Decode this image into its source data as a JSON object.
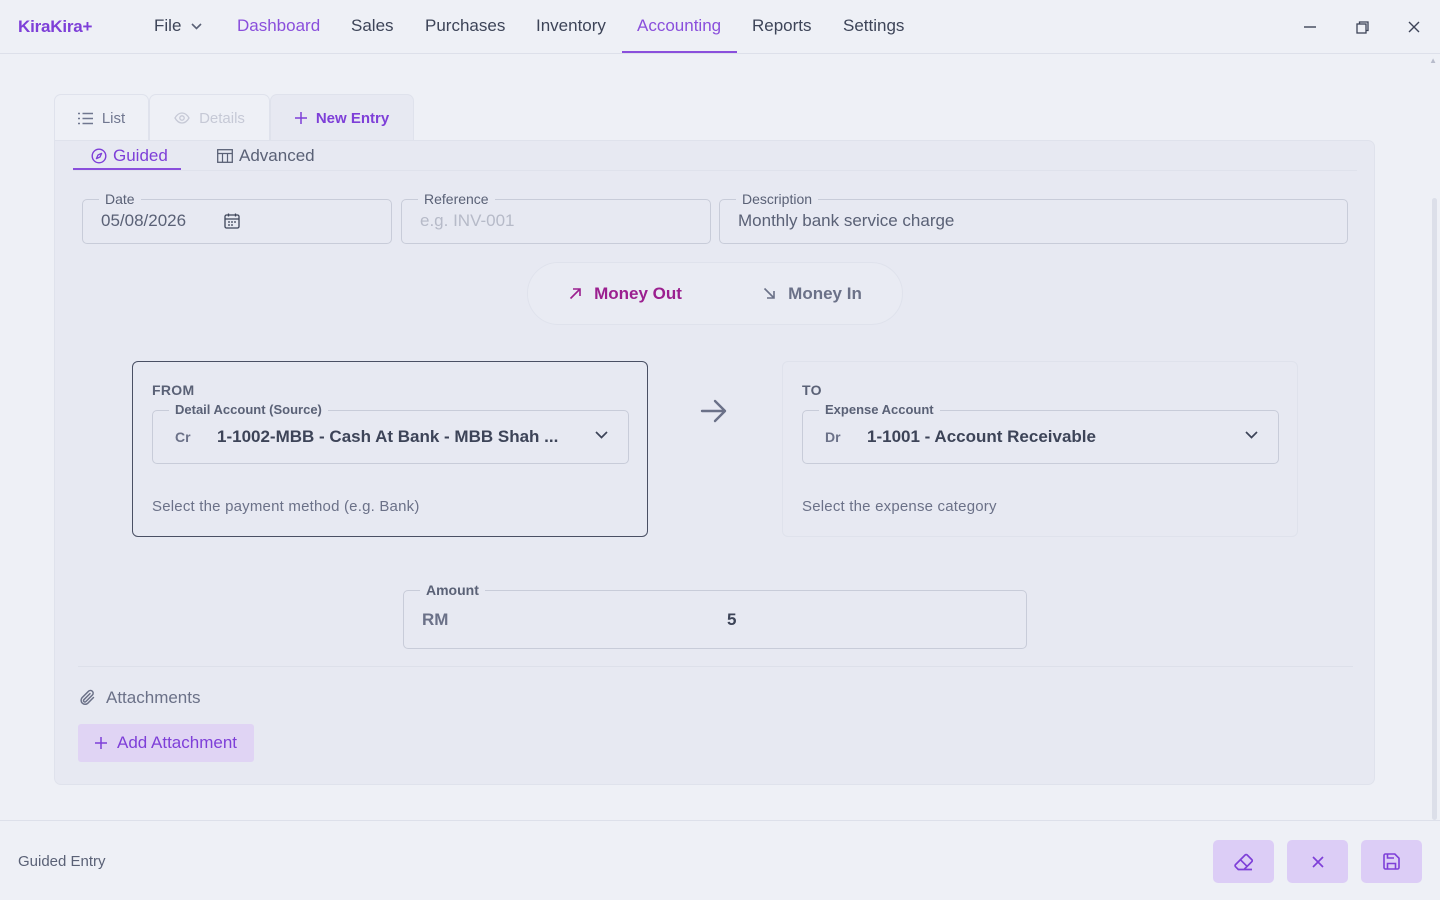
{
  "app": {
    "logo": "KiraKira+"
  },
  "menu": {
    "file_label": "File",
    "items": [
      "Dashboard",
      "Sales",
      "Purchases",
      "Inventory",
      "Accounting",
      "Reports",
      "Settings"
    ]
  },
  "tabs": {
    "list": "List",
    "details": "Details",
    "new_entry": "New Entry"
  },
  "modes": {
    "guided": "Guided",
    "advanced": "Advanced"
  },
  "form": {
    "date_label": "Date",
    "date_value": "05/08/2026",
    "reference_label": "Reference",
    "reference_placeholder": "e.g. INV-001",
    "description_label": "Description",
    "description_value": "Monthly bank service charge"
  },
  "direction": {
    "out_label": "Money Out",
    "in_label": "Money In",
    "selected": "Money Out"
  },
  "from": {
    "title": "FROM",
    "field_label": "Detail Account (Source)",
    "dc": "Cr",
    "value": "1-1002-MBB - Cash At Bank - MBB Shah ...",
    "help": "Select the payment method (e.g. Bank)"
  },
  "to": {
    "title": "TO",
    "field_label": "Expense Account",
    "dc": "Dr",
    "value": "1-1001 - Account Receivable",
    "help": "Select the expense category"
  },
  "amount": {
    "label": "Amount",
    "currency": "RM",
    "value": "5"
  },
  "attachments": {
    "title": "Attachments",
    "add_label": "Add Attachment"
  },
  "footer": {
    "label": "Guided Entry"
  },
  "colors": {
    "accent": "#7e3fd8",
    "money_out": "#9b1f8f",
    "button_bg": "#dccdf6"
  }
}
